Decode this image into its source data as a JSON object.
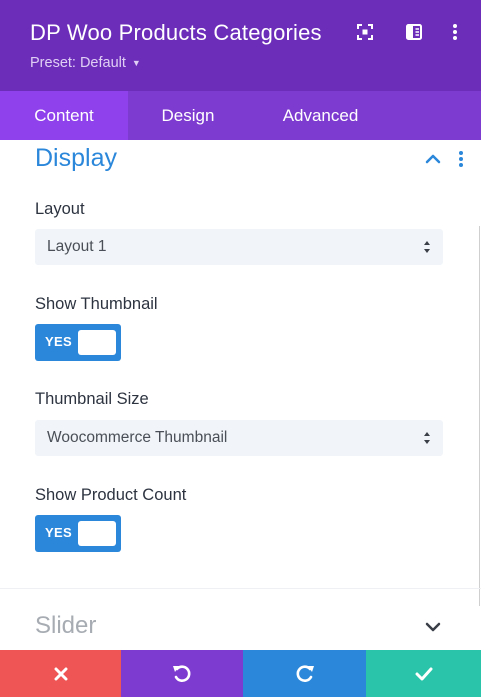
{
  "header": {
    "title": "DP Woo Products Categories",
    "preset_label": "Preset: Default",
    "icons": [
      "focus-icon",
      "sidebar-layout-icon",
      "more-vertical-icon"
    ]
  },
  "tabs": [
    {
      "label": "Content",
      "active": true
    },
    {
      "label": "Design",
      "active": false
    },
    {
      "label": "Advanced",
      "active": false
    }
  ],
  "display_section": {
    "title": "Display",
    "expanded": true,
    "fields": {
      "layout": {
        "label": "Layout",
        "value": "Layout 1"
      },
      "show_thumbnail": {
        "label": "Show Thumbnail",
        "toggle_text": "YES",
        "on": true
      },
      "thumbnail_size": {
        "label": "Thumbnail Size",
        "value": "Woocommerce Thumbnail"
      },
      "show_product_count": {
        "label": "Show Product Count",
        "toggle_text": "YES",
        "on": true
      }
    }
  },
  "slider_section": {
    "title": "Slider",
    "expanded": false
  },
  "footer": {
    "buttons": [
      "close-icon",
      "undo-icon",
      "redo-icon",
      "check-icon"
    ]
  },
  "colors": {
    "header_bg": "#6c2eb9",
    "tabs_bg": "#7e3bd0",
    "active_tab_bg": "#8f42ec",
    "accent_blue": "#2b87da",
    "cancel_red": "#ef5555",
    "save_green": "#29c4a9"
  }
}
